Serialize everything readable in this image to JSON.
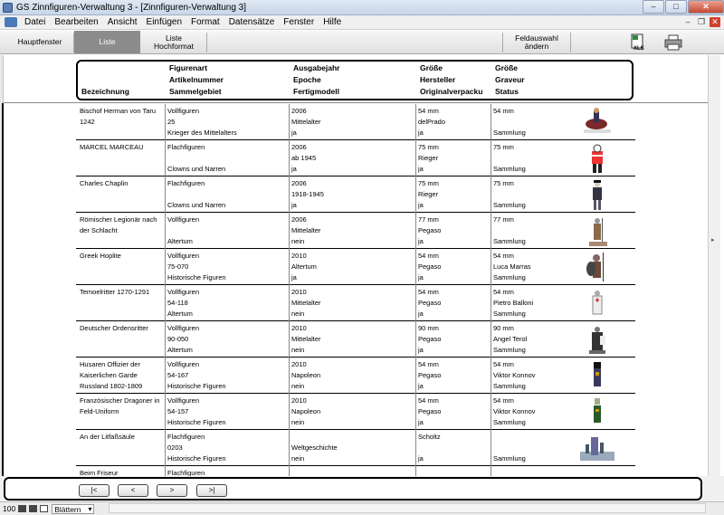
{
  "window": {
    "title": "GS Zinnfiguren-Verwaltung 3 - [Zinnfiguren-Verwaltung 3]",
    "min": "–",
    "max": "□",
    "close": "✕"
  },
  "menu": [
    "Datei",
    "Bearbeiten",
    "Ansicht",
    "Einfügen",
    "Format",
    "Datensätze",
    "Fenster",
    "Hilfe"
  ],
  "mdi": {
    "min": "–",
    "restore": "❐",
    "close": "✕"
  },
  "toolbar": {
    "hauptfenster": "Hauptfenster",
    "liste": "Liste",
    "liste_hochformat_1": "Liste",
    "liste_hochformat_2": "Hochformat",
    "feldauswahl_1": "Feldauswahl",
    "feldauswahl_2": "ändern",
    "xls_label": "XLS"
  },
  "header": {
    "col1": [
      "",
      "",
      "Bezeichnung"
    ],
    "col2": [
      "Figurenart",
      "Artikelnummer",
      "Sammelgebiet"
    ],
    "col3": [
      "Ausgabejahr",
      "Epoche",
      "Fertigmodell"
    ],
    "col4": [
      "Größe",
      "Hersteller",
      "Originalverpacku"
    ],
    "col5": [
      "Größe",
      "Graveur",
      "Status"
    ]
  },
  "rows": [
    {
      "name": [
        "Bischof Herman von Taru",
        "1242"
      ],
      "c2": [
        "Vollfiguren",
        "25",
        "Krieger des Mittelalters"
      ],
      "c3": [
        "2006",
        "Mittelalter",
        "ja"
      ],
      "c4": [
        "54 mm",
        "delPrado",
        "ja"
      ],
      "c5": [
        "54 mm",
        "",
        "Sammlung"
      ],
      "thumb": "rider"
    },
    {
      "name": [
        "MARCEL MARCEAU",
        ""
      ],
      "c2": [
        "Flachfiguren",
        "",
        "Clowns und Narren"
      ],
      "c3": [
        "2006",
        "ab 1945",
        "ja"
      ],
      "c4": [
        "75 mm",
        "Rieger",
        "ja"
      ],
      "c5": [
        "75 mm",
        "",
        "Sammlung"
      ],
      "thumb": "mime"
    },
    {
      "name": [
        "Charles Chaplin",
        ""
      ],
      "c2": [
        "Flachfiguren",
        "",
        "Clowns und Narren"
      ],
      "c3": [
        "2006",
        "1918-1945",
        "ja"
      ],
      "c4": [
        "75 mm",
        "Rieger",
        "ja"
      ],
      "c5": [
        "75 mm",
        "",
        "Sammlung"
      ],
      "thumb": "chaplin"
    },
    {
      "name": [
        "Römischer Legionär nach",
        "der Schlacht"
      ],
      "c2": [
        "Vollfiguren",
        "",
        "Altertum"
      ],
      "c3": [
        "2006",
        "Mittelalter",
        "nein"
      ],
      "c4": [
        "77 mm",
        "Pegaso",
        "ja"
      ],
      "c5": [
        "77 mm",
        "",
        "Sammlung"
      ],
      "thumb": "legionary"
    },
    {
      "name": [
        "Greek Hoplite",
        ""
      ],
      "c2": [
        "Vollfiguren",
        "75-070",
        "Historische Figuren"
      ],
      "c3": [
        "2010",
        "Altertum",
        "ja"
      ],
      "c4": [
        "54 mm",
        "Pegaso",
        "ja"
      ],
      "c5": [
        "54 mm",
        "Luca Marras",
        "Sammlung"
      ],
      "thumb": "hoplite"
    },
    {
      "name": [
        "Temoelritter 1270-1291",
        ""
      ],
      "c2": [
        "Vollfiguren",
        "54-118",
        "Altertum"
      ],
      "c3": [
        "2010",
        "Mittelalter",
        "nein"
      ],
      "c4": [
        "54 mm",
        "Pegaso",
        "ja"
      ],
      "c5": [
        "54 mm",
        "Pietro Balloni",
        "Sammlung"
      ],
      "thumb": "knight"
    },
    {
      "name": [
        "Deutscher Ordensritter",
        ""
      ],
      "c2": [
        "Vollfiguren",
        "90-050",
        "Altertum"
      ],
      "c3": [
        "2010",
        "Mittelalter",
        "nein"
      ],
      "c4": [
        "90 mm",
        "Pegaso",
        "ja"
      ],
      "c5": [
        "90 mm",
        "Angel Terol",
        "Sammlung"
      ],
      "thumb": "order"
    },
    {
      "name": [
        "Husaren Offizier der",
        "Kaiserlichen Garde",
        "Russland 1802-1809"
      ],
      "c2": [
        "Vollfiguren",
        "54-167",
        "Historische Figuren"
      ],
      "c3": [
        "2010",
        "Napoleon",
        "nein"
      ],
      "c4": [
        "54 mm",
        "Pegaso",
        "ja"
      ],
      "c5": [
        "54 mm",
        "Viktor Konnov",
        "Sammlung"
      ],
      "thumb": "hussar"
    },
    {
      "name": [
        "Französischer Dragoner in",
        "Feld-Uniform"
      ],
      "c2": [
        "Vollfiguren",
        "54-157",
        "Historische Figuren"
      ],
      "c3": [
        "2010",
        "Napoleon",
        "nein"
      ],
      "c4": [
        "54 mm",
        "Pegaso",
        "ja"
      ],
      "c5": [
        "54 mm",
        "Viktor Konnov",
        "Sammlung"
      ],
      "thumb": "dragoon"
    },
    {
      "name": [
        "An der Litfaßsäule",
        ""
      ],
      "c2": [
        "Flachfiguren",
        "0203",
        "Historische Figuren"
      ],
      "c3": [
        "",
        "Weltgeschichte",
        "nein"
      ],
      "c4": [
        "Scholtz",
        "",
        "ja"
      ],
      "c5": [
        "",
        "",
        "Sammlung"
      ],
      "thumb": "diorama"
    },
    {
      "name": [
        "Beim Friseur",
        ""
      ],
      "c2": [
        "Flachfiguren",
        "",
        ""
      ],
      "c3": [
        "",
        "",
        ""
      ],
      "c4": [
        "",
        "",
        ""
      ],
      "c5": [
        "",
        "",
        ""
      ],
      "thumb": "none"
    }
  ],
  "nav": {
    "first": "|<",
    "prev": "<",
    "next": ">",
    "last": ">|"
  },
  "status": {
    "zoom": "100",
    "mode": "Blättern"
  }
}
